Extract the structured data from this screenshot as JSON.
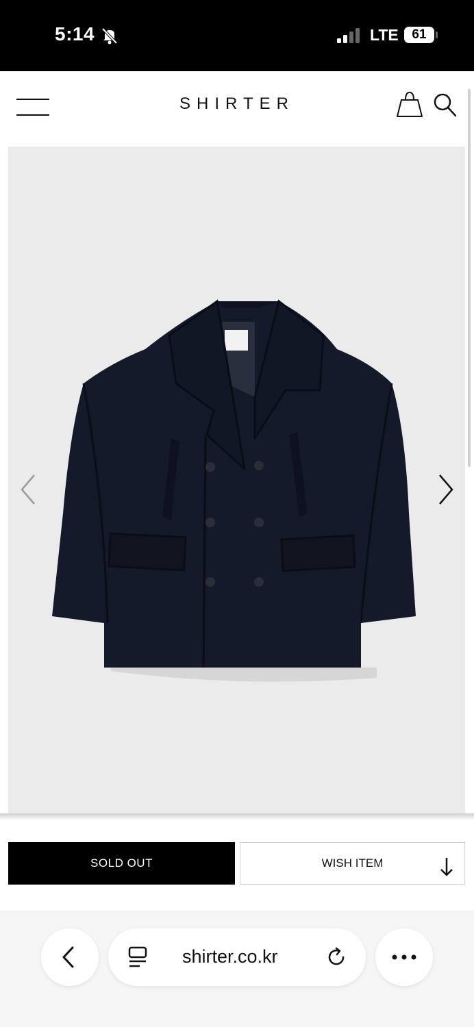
{
  "status_bar": {
    "time": "5:14",
    "carrier": "LTE",
    "battery": "61",
    "icons": [
      "bell-slash-icon",
      "signal-icon"
    ]
  },
  "header": {
    "logo": "SHIRTER",
    "icons": [
      "menu-icon",
      "shopping-bag-icon",
      "search-icon"
    ]
  },
  "product": {
    "image_icons": [
      "chevron-left-icon",
      "chevron-right-icon"
    ],
    "colors": {
      "image_bg": "#ebebeb",
      "coat": "#151a2a"
    }
  },
  "actions": {
    "sold_out_label": "SOLD OUT",
    "wish_item_label": "WISH ITEM"
  },
  "browser": {
    "url": "shirter.co.kr",
    "icons": [
      "back-icon",
      "reader-icon",
      "reload-icon",
      "more-icon"
    ]
  }
}
